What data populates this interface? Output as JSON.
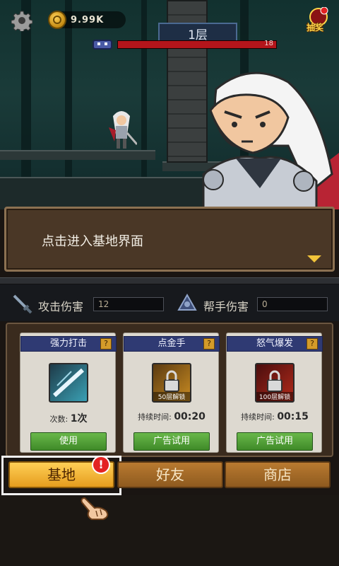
{
  "top_bar": {
    "settings_icon": "gear-icon",
    "coin_icon": "coin-icon",
    "coins": "9.99K",
    "lottery_label": "抽奖",
    "lottery_icon": "lottery-icon"
  },
  "floor": {
    "label": "1层",
    "boss_hp": "18"
  },
  "dialog": {
    "text": "点击进入基地界面"
  },
  "stats": {
    "attack_label": "攻击伤害",
    "attack_value": "12",
    "helper_label": "帮手伤害",
    "helper_value": "0"
  },
  "skills": [
    {
      "name": "强力打击",
      "info_label": "?",
      "info_line_label": "次数:",
      "info_line_value": "1次",
      "button": "使用",
      "lock_caption": ""
    },
    {
      "name": "点金手",
      "info_label": "?",
      "info_line_label": "持续时间:",
      "info_line_value": "00:20",
      "button": "广告试用",
      "lock_caption": "50层解锁"
    },
    {
      "name": "怒气爆发",
      "info_label": "?",
      "info_line_label": "持续时间:",
      "info_line_value": "00:15",
      "button": "广告试用",
      "lock_caption": "100层解锁"
    }
  ],
  "nav": {
    "base": "基地",
    "friends": "好友",
    "shop": "商店",
    "alert": "!"
  },
  "colors": {
    "accent_gold": "#f2c43a",
    "hp_red": "#b4151b",
    "skill_header": "#2f3a73",
    "button_green": "#4f9d34"
  }
}
